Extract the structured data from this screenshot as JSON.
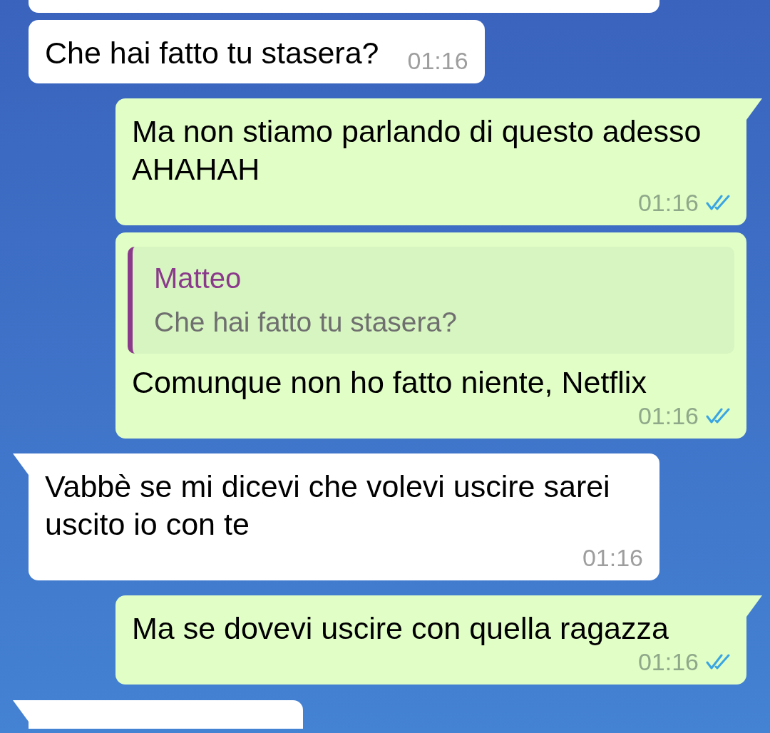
{
  "messages": [
    {
      "kind": "incoming",
      "text": "Che hai fatto tu stasera?",
      "time": "01:16",
      "tail": false
    },
    {
      "kind": "outgoing",
      "text": "Ma non stiamo parlando di questo adesso AHAHAH",
      "time": "01:16",
      "read": true,
      "tail": true
    },
    {
      "kind": "outgoing",
      "reply": {
        "author": "Matteo",
        "text": "Che hai fatto tu stasera?"
      },
      "text": "Comunque non ho fatto niente, Netflix",
      "time": "01:16",
      "read": true,
      "tail": false
    },
    {
      "kind": "incoming",
      "text": "Vabbè se mi dicevi che volevi uscire sarei uscito io con te",
      "time": "01:16",
      "tail": true
    },
    {
      "kind": "outgoing",
      "text": "Ma se dovevi uscire con quella ragazza",
      "time": "01:16",
      "read": true,
      "tail": true
    }
  ]
}
